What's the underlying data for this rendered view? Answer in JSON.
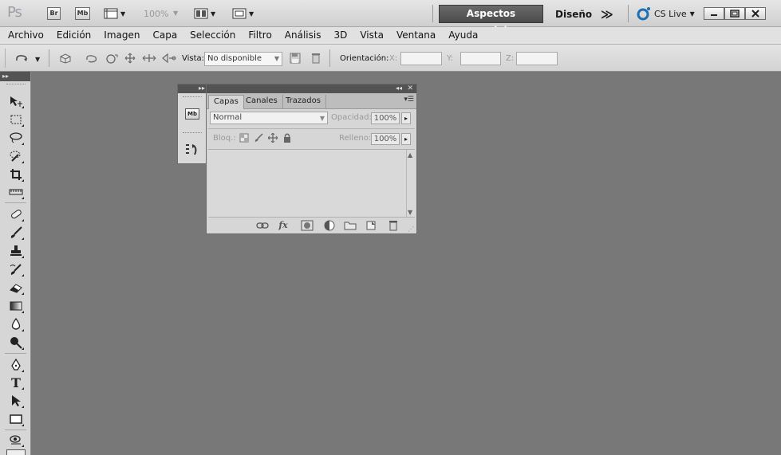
{
  "appbar": {
    "logo": "Ps",
    "bridge_label": "Br",
    "minibridge_label": "Mb",
    "zoom": "100%",
    "workspaces": {
      "active": "Aspectos esenciales",
      "other": "Diseño",
      "more": "≫"
    },
    "cslive_label": "CS Live"
  },
  "menubar": {
    "items": [
      "Archivo",
      "Edición",
      "Imagen",
      "Capa",
      "Selección",
      "Filtro",
      "Análisis",
      "3D",
      "Vista",
      "Ventana",
      "Ayuda"
    ]
  },
  "options": {
    "vista_label": "Vista:",
    "vista_value": "No disponible",
    "orientacion_label": "Orientación:",
    "x_label": "X:",
    "y_label": "Y:",
    "z_label": "Z:"
  },
  "layers_panel": {
    "tabs": [
      "Capas",
      "Canales",
      "Trazados"
    ],
    "blend_mode": "Normal",
    "opacity_label": "Opacidad:",
    "opacity_value": "100%",
    "lock_label": "Bloq.:",
    "fill_label": "Relleno:",
    "fill_value": "100%"
  },
  "dock": {
    "minibridge_label": "Mb"
  },
  "colors": {
    "workspace_bg": "#787878",
    "chrome": "#d6d6d6",
    "panel_header": "#535353"
  }
}
